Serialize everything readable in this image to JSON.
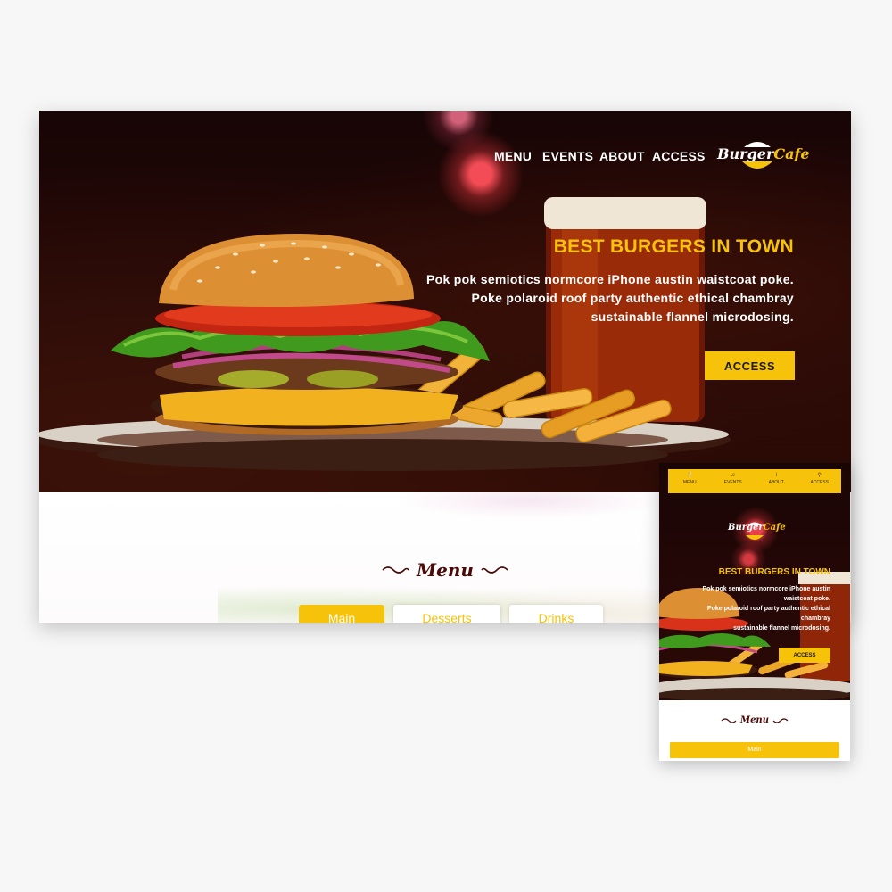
{
  "desktop": {
    "nav": {
      "items": [
        "MENU",
        "EVENTS",
        "ABOUT",
        "ACCESS"
      ]
    },
    "logo": {
      "word1": "Burger",
      "word2": "Cafe"
    },
    "hero": {
      "title": "BEST BURGERS IN TOWN",
      "lines": [
        "Pok pok semiotics normcore iPhone austin waistcoat poke.",
        "Poke polaroid roof party authentic ethical chambray",
        "sustainable flannel microdosing."
      ],
      "button": "ACCESS"
    },
    "menu_section": {
      "title": "Menu",
      "tabs": [
        "Main",
        "Desserts",
        "Drinks"
      ],
      "active_tab": "Main"
    }
  },
  "mobile": {
    "nav": {
      "items": [
        {
          "icon": "utensils-icon",
          "glyph": "🍴",
          "label": "MENU"
        },
        {
          "icon": "music-note-icon",
          "glyph": "♫",
          "label": "EVENTS"
        },
        {
          "icon": "info-icon",
          "glyph": "i",
          "label": "ABOUT"
        },
        {
          "icon": "map-pin-icon",
          "glyph": "⚲",
          "label": "ACCESS"
        }
      ]
    },
    "logo": {
      "word1": "Burger",
      "word2": "Cafe"
    },
    "hero": {
      "title": "BEST BURGERS IN TOWN",
      "lines": [
        "Pok pok semiotics normcore iPhone austin",
        "waistcoat poke.",
        "Poke polaroid roof party authentic ethical",
        "chambray",
        "sustainable flannel microdosing."
      ],
      "button": "ACCESS"
    },
    "menu_section": {
      "title": "Menu",
      "tab": "Main"
    }
  },
  "colors": {
    "accent": "#f6c20a",
    "dark_red": "#4a0a08",
    "hero_bg": "#1f0606"
  }
}
